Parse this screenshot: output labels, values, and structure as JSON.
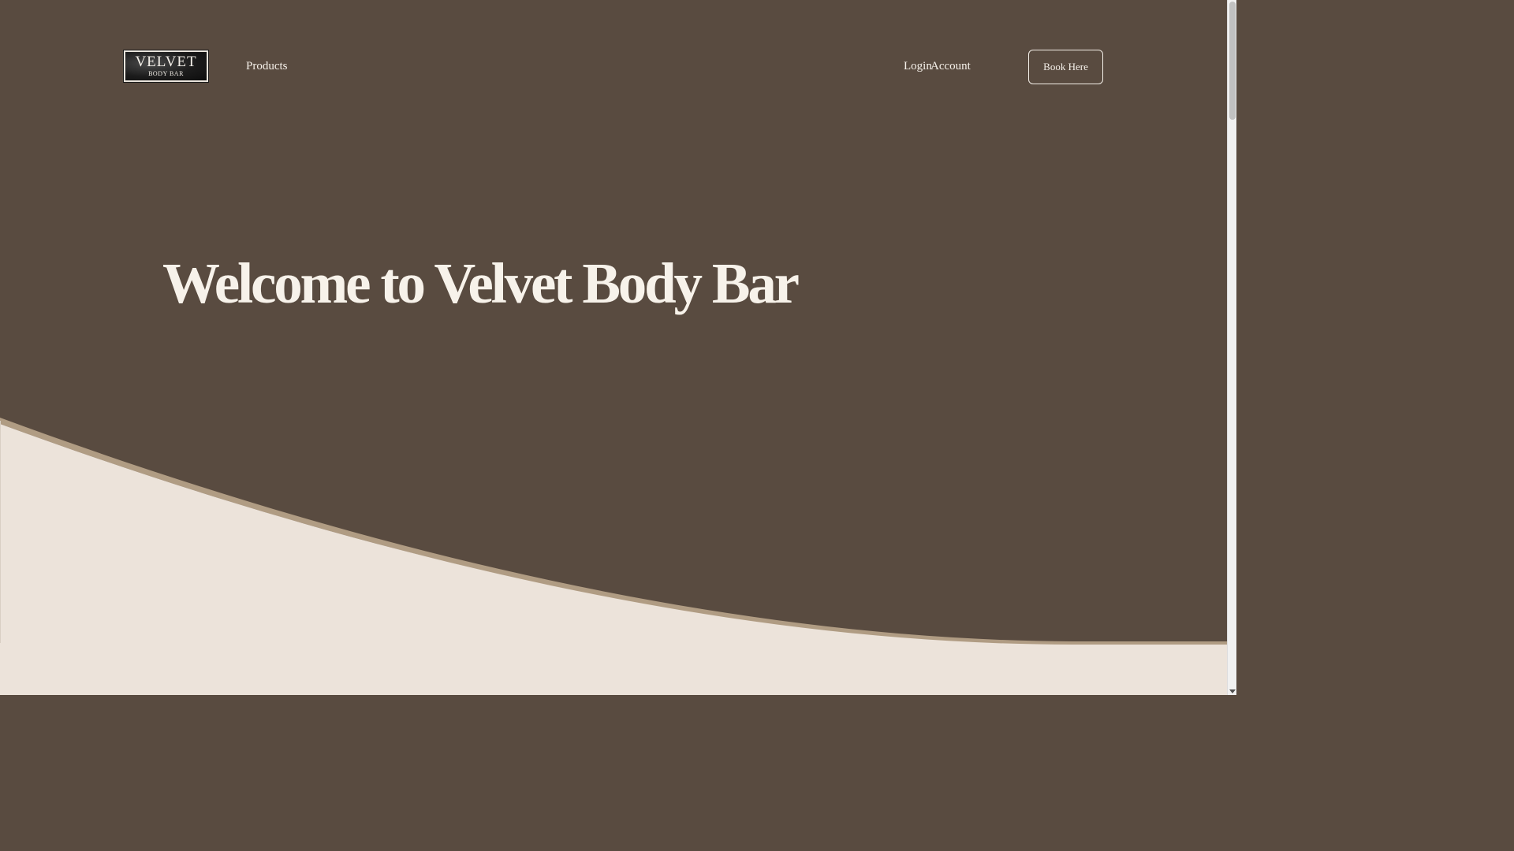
{
  "header": {
    "logo": {
      "title": "VELVET",
      "subtitle": "BODY BAR"
    },
    "nav": {
      "products": "Products",
      "login": "Login",
      "account": "Account"
    },
    "book_button": "Book Here"
  },
  "hero": {
    "title": "Welcome to Velvet Body Bar"
  },
  "colors": {
    "background": "#594b40",
    "cream": "#ece3da",
    "accent_line": "#b09c83",
    "text": "#f7f2ea"
  }
}
